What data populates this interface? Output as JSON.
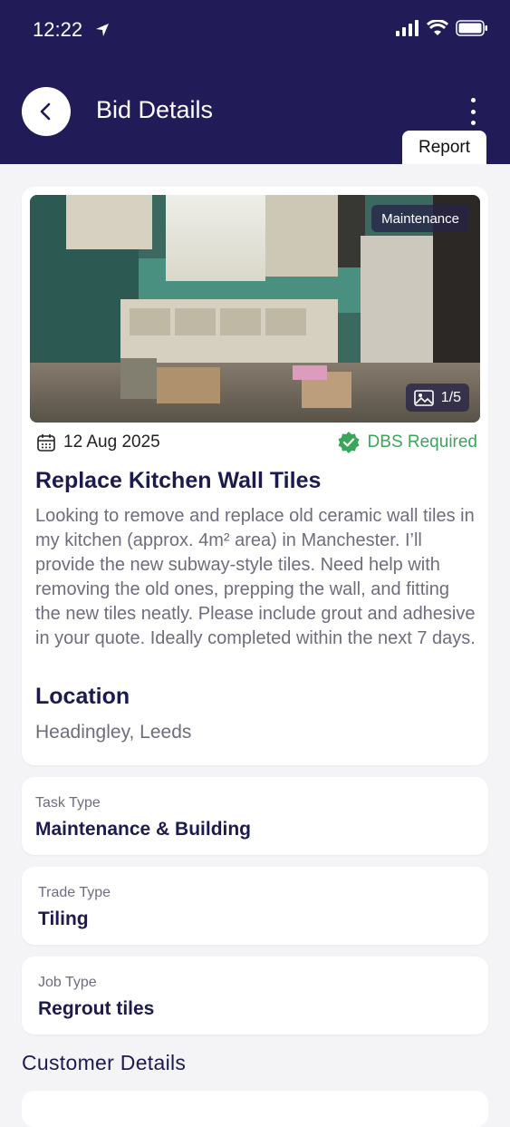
{
  "status_bar": {
    "time": "12:22"
  },
  "header": {
    "title": "Bid Details",
    "report_label": "Report"
  },
  "job": {
    "category_tag": "Maintenance",
    "image_counter": "1/5",
    "date": "12 Aug 2025",
    "dbs_label": "DBS Required",
    "title": "Replace Kitchen Wall Tiles",
    "description": "Looking to remove and replace old ceramic wall tiles in my kitchen (approx. 4m² area) in Manchester. I’ll provide the new subway-style tiles. Need help with removing the old ones, prepping the wall, and fitting the new tiles neatly. Please include grout and adhesive in your quote. Ideally completed within the next 7 days.",
    "location_heading": "Location",
    "location": "Headingley, Leeds"
  },
  "details": [
    {
      "label": "Task Type",
      "value": "Maintenance & Building"
    },
    {
      "label": "Trade Type",
      "value": "Tiling"
    },
    {
      "label": "Job Type",
      "value": "Regrout tiles"
    }
  ],
  "customer_section_title": "Customer Details",
  "colors": {
    "header_bg": "#211c58",
    "accent_green": "#3ca55c",
    "text_dark": "#1d1b4e",
    "text_muted": "#6e6d7e"
  }
}
